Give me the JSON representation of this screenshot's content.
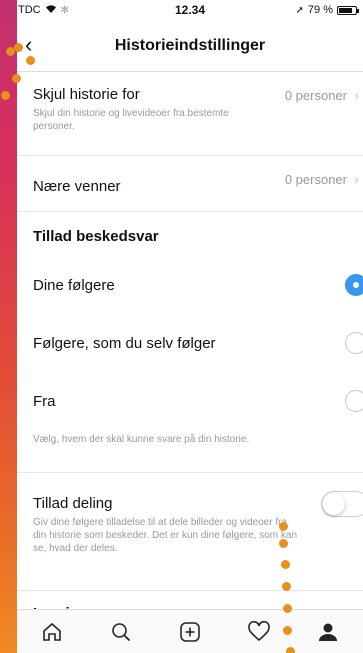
{
  "status": {
    "carrier": "TDC",
    "time": "12.34",
    "battery": "79 %",
    "battery_level": 0.79
  },
  "header": {
    "title": "Historieindstillinger",
    "back_icon": "chevron-left-icon"
  },
  "hide_story": {
    "label": "Skjul historie for",
    "value": "0 personer",
    "description": "Skjul din historie og livevideoer fra bestemte personer."
  },
  "close_friends": {
    "label": "Nære venner",
    "value": "0 personer"
  },
  "replies": {
    "heading": "Tillad beskedsvar",
    "options": [
      {
        "label": "Dine følgere",
        "selected": true
      },
      {
        "label": "Følgere, som du selv følger",
        "selected": false
      },
      {
        "label": "Fra",
        "selected": false
      }
    ],
    "note": "Vælg, hvem der skal kunne svare på din historie."
  },
  "sharing": {
    "label": "Tillad deling",
    "description": "Giv dine følgere tilladelse til at dele billeder og videoer fra din historie som beskeder. Det er kun dine følgere, som kan se, hvad der deles.",
    "enabled": false
  },
  "saving": {
    "label": "Lagring"
  },
  "tabbar": {
    "icons": [
      "home-icon",
      "search-icon",
      "add-icon",
      "heart-icon",
      "profile-icon"
    ]
  },
  "colors": {
    "accent": "#3897f0",
    "dot": "#e8901c"
  }
}
